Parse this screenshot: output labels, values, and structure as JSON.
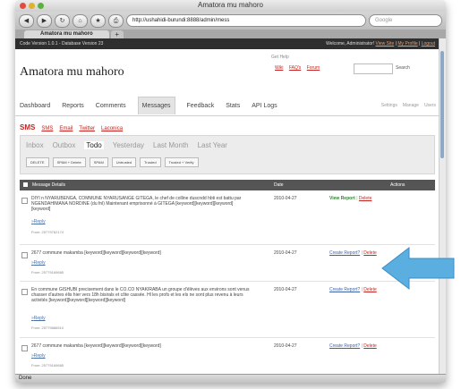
{
  "browser": {
    "title": "Amatora mu mahoro",
    "url": "http://ushahidi-burundi:8888/admin/mess",
    "search_placeholder": "Google",
    "tab_label": "Amatora mu mahoro",
    "new_tab": "+",
    "status": "Done"
  },
  "admin_bar": {
    "left": "Code Version 1.0.1 - Database Version 23",
    "welcome": "Welcome, Administrator!",
    "view_site": "View Site",
    "my_profile": "My Profile",
    "logout": "Logout"
  },
  "header": {
    "site_title": "Amatora mu mahoro",
    "help_label": "Get Help",
    "help_links": [
      "Wiki",
      "FAQ's",
      "Forum"
    ],
    "search_label": "Search"
  },
  "nav": {
    "tabs": [
      "Dashboard",
      "Reports",
      "Comments",
      "Messages",
      "Feedback",
      "Stats",
      "API Logs"
    ],
    "active": "Messages",
    "right": [
      "Settings",
      "Manage",
      "Users"
    ]
  },
  "subtabs": {
    "current": "SMS",
    "items": [
      "SMS",
      "Email",
      "Twitter",
      "Laconica"
    ]
  },
  "filters": {
    "periods": [
      "Inbox",
      "Outbox",
      "Todo",
      "Yesterday",
      "Last Month",
      "Last Year"
    ],
    "active": "Todo",
    "actions": [
      "DELETE",
      "SPAM + Delete",
      "SPAM",
      "Untrusted",
      "Trusted",
      "Trusted + Verify"
    ]
  },
  "table": {
    "headers": {
      "details": "Message Details",
      "date": "Date",
      "actions": "Actions"
    },
    "reply_label": "Reply",
    "rows": [
      {
        "message": "DIYI n NYARUBENGA, COMMUNE NYARUSANGE GITEGA, le chef de colline duscndd hbti est battu par NGENDAHIMANA NORDINE (du fnl) Maintenant emprisonné à GITEGA [keyword][keyword][keyword][keyword]",
        "from": "From: 25779762174",
        "date": "2010-04-27",
        "action": "View Report",
        "delete": "Delete"
      },
      {
        "message": "2677 commune makamba [keyword][keyword][keyword][keyword]",
        "from": "From: 25779169685",
        "date": "2010-04-27",
        "action": "Create Report?",
        "delete": "Delete"
      },
      {
        "message": "En commune GISHUBI precisement dans le CO.CO NYAKIRABA un groupe d'élèves aux environs sont venus chasser d'autres élis hier vers 18h bisirals et côte cassée. Hl les profs et les els ne sont plus revenu à leurs activités [keyword][keyword][keyword][keyword]",
        "from": "From: 25779886510",
        "date": "2010-04-27",
        "action": "Create Report?",
        "delete": "Delete"
      },
      {
        "message": "2677 commune makamba [keyword][keyword][keyword][keyword]",
        "from": "From: 25779169685",
        "date": "2010-04-27",
        "action": "Create Report?",
        "delete": "Delete"
      }
    ]
  },
  "colors": {
    "arrow": "#5aaee0",
    "link_red": "#c4231f",
    "view_report_green": "#2d8a2d",
    "admin_bar": "#2f2f2f"
  }
}
